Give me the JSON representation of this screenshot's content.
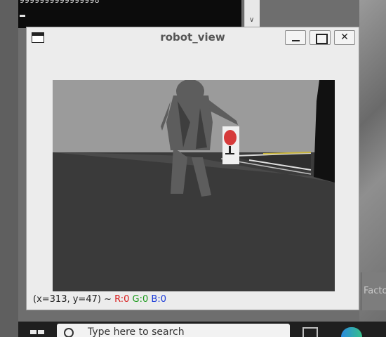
{
  "terminal": {
    "output_line": "9999999999999998",
    "scroll_down_arrow": "∨"
  },
  "window": {
    "title": "robot_view",
    "buttons": {
      "minimize": "",
      "maximize": "",
      "close": "✕"
    }
  },
  "status": {
    "coords": "(x=313, y=47) ~ ",
    "r": "R:0",
    "g": "G:0",
    "b": "B:0"
  },
  "background": {
    "right_panel_text": "Facto"
  },
  "taskbar": {
    "search_placeholder": "Type here to search"
  },
  "icons": {
    "app": "window-icon",
    "start": "windows-icon",
    "search": "search-icon"
  },
  "colors": {
    "r": "#d81a1a",
    "g": "#1a9a1a",
    "b": "#1a3ad8"
  }
}
